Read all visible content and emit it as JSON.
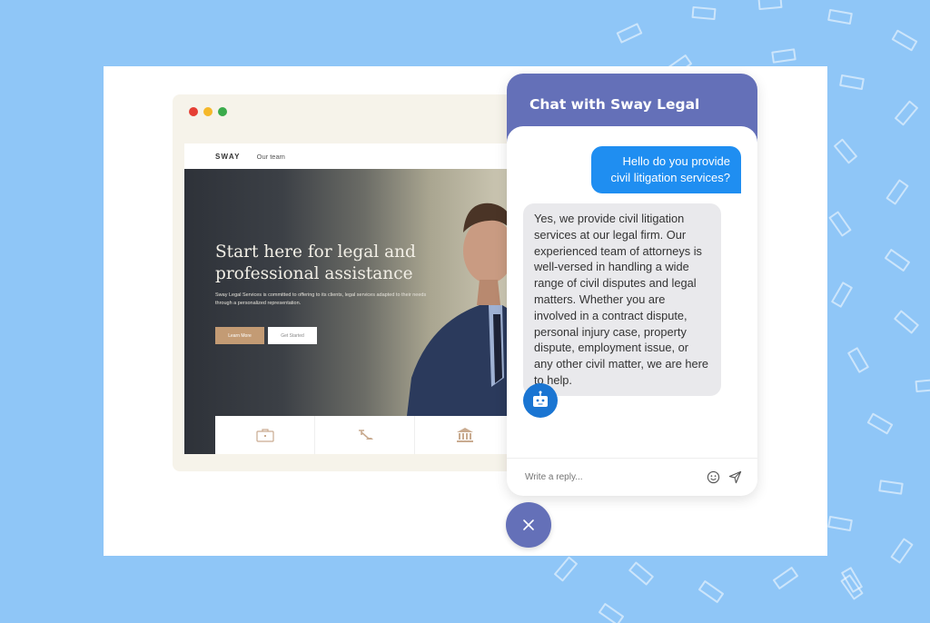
{
  "website": {
    "brand": "SWAY",
    "nav_links": [
      "Our team"
    ],
    "hero_title": "Start here for legal and professional assistance",
    "hero_description": "Sway Legal Services is committed to offering to its clients, legal services adapted to their needs through a personalized representation.",
    "buttons": {
      "learn_more": "Learn More",
      "get_started": "Get Started"
    },
    "service_icons": [
      "briefcase-icon",
      "gavel-icon",
      "courthouse-icon"
    ],
    "window_dots": {
      "close": "#e53f35",
      "minimize": "#f5b82a",
      "maximize": "#3bab4b"
    },
    "accent_color": "#c39b74"
  },
  "chat": {
    "title": "Chat with Sway Legal",
    "header_color": "#6470b8",
    "messages": [
      {
        "sender": "user",
        "text": "Hello do you provide civil litigation services?"
      },
      {
        "sender": "bot",
        "text": "Yes, we provide civil litigation services at our legal firm. Our experienced team of attorneys is well-versed in handling a wide range of civil disputes and legal matters. Whether you are involved in a contract dispute, personal injury case, property dispute, employment issue, or any other civil matter, we are here to help."
      }
    ],
    "bot_avatar_icon": "robot-icon",
    "input_placeholder": "Write a reply...",
    "input_value": "",
    "footer_icons": [
      "emoji-icon",
      "send-icon"
    ],
    "close_button_icon": "close-icon",
    "user_bubble_color": "#1f8ef1",
    "bot_bubble_color": "#e9e9ec"
  },
  "background_color": "#8fc6f7"
}
